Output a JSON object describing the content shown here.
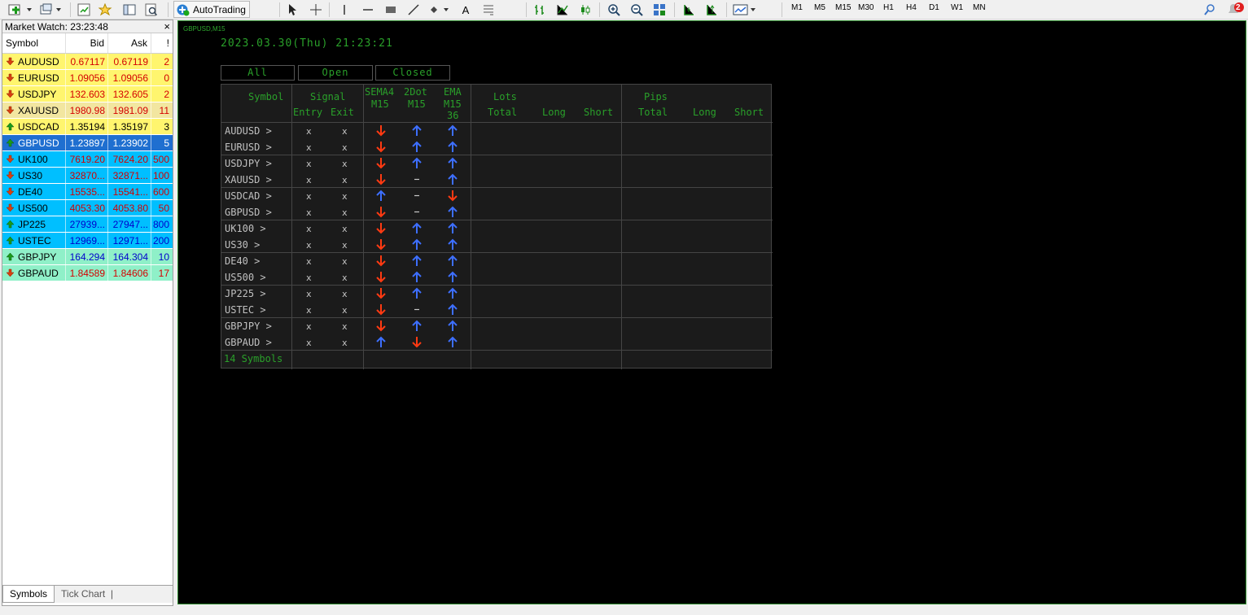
{
  "toolbar": {
    "autotrading_label": "AutoTrading",
    "timeframes": [
      "M1",
      "M5",
      "M15",
      "M30",
      "H1",
      "H4",
      "D1",
      "W1",
      "MN"
    ],
    "notification_count": "2"
  },
  "market_watch": {
    "title": "Market Watch: 23:23:48",
    "columns": {
      "symbol": "Symbol",
      "bid": "Bid",
      "ask": "Ask",
      "spread": "!"
    },
    "rows": [
      {
        "symbol": "AUDUSD",
        "bid": "0.67117",
        "ask": "0.67119",
        "spread": "2",
        "dir": "down",
        "bg": "#fff56e",
        "color": "#d40000"
      },
      {
        "symbol": "EURUSD",
        "bid": "1.09056",
        "ask": "1.09056",
        "spread": "0",
        "dir": "down",
        "bg": "#fff56e",
        "color": "#d40000"
      },
      {
        "symbol": "USDJPY",
        "bid": "132.603",
        "ask": "132.605",
        "spread": "2",
        "dir": "down",
        "bg": "#fff56e",
        "color": "#d40000"
      },
      {
        "symbol": "XAUUSD",
        "bid": "1980.98",
        "ask": "1981.09",
        "spread": "11",
        "dir": "down",
        "bg": "#f2e6a0",
        "color": "#d40000"
      },
      {
        "symbol": "USDCAD",
        "bid": "1.35194",
        "ask": "1.35197",
        "spread": "3",
        "dir": "up",
        "bg": "#fff56e",
        "color": "#000000"
      },
      {
        "symbol": "GBPUSD",
        "bid": "1.23897",
        "ask": "1.23902",
        "spread": "5",
        "dir": "up",
        "bg": "#1f6fd0",
        "color": "#ffffff",
        "selected": true
      },
      {
        "symbol": "UK100",
        "bid": "7619.20",
        "ask": "7624.20",
        "spread": "500",
        "dir": "down",
        "bg": "#00bfff",
        "color": "#d40000"
      },
      {
        "symbol": "US30",
        "bid": "32870...",
        "ask": "32871...",
        "spread": "100",
        "dir": "down",
        "bg": "#00bfff",
        "color": "#d40000"
      },
      {
        "symbol": "DE40",
        "bid": "15535...",
        "ask": "15541...",
        "spread": "600",
        "dir": "down",
        "bg": "#00bfff",
        "color": "#d40000"
      },
      {
        "symbol": "US500",
        "bid": "4053.30",
        "ask": "4053.80",
        "spread": "50",
        "dir": "down",
        "bg": "#00bfff",
        "color": "#d40000"
      },
      {
        "symbol": "JP225",
        "bid": "27939...",
        "ask": "27947...",
        "spread": "800",
        "dir": "up",
        "bg": "#00bfff",
        "color": "#0000cc"
      },
      {
        "symbol": "USTEC",
        "bid": "12969...",
        "ask": "12971...",
        "spread": "200",
        "dir": "up",
        "bg": "#00bfff",
        "color": "#0000cc"
      },
      {
        "symbol": "GBPJPY",
        "bid": "164.294",
        "ask": "164.304",
        "spread": "10",
        "dir": "up",
        "bg": "#8ff0c8",
        "color": "#0000cc"
      },
      {
        "symbol": "GBPAUD",
        "bid": "1.84589",
        "ask": "1.84606",
        "spread": "17",
        "dir": "down",
        "bg": "#8ff0c8",
        "color": "#d40000"
      }
    ],
    "tabs": [
      "Symbols",
      "Tick Chart"
    ]
  },
  "chart": {
    "label": "GBPUSD,M15",
    "datetime": "2023.03.30(Thu) 21:23:21",
    "filters": [
      "All",
      "Open",
      "Closed"
    ],
    "headers": {
      "symbol": "Symbol",
      "signal": "Signal",
      "entry": "Entry",
      "exit": "Exit",
      "sema_top": "SEMA4",
      "sema_bot": "M15",
      "dot_top": "2Dot",
      "dot_bot": "M15",
      "ema_top": "EMA",
      "ema_mid": "M15",
      "ema_bot": "36",
      "lots": "Lots",
      "lots_total": "Total",
      "lots_long": "Long",
      "lots_short": "Short",
      "pips": "Pips",
      "pips_total": "Total",
      "pips_long": "Long",
      "pips_short": "Short"
    },
    "rows": [
      {
        "symbol": "AUDUSD",
        "entry": "x",
        "exit": "x",
        "sema": "down",
        "dot": "up",
        "ema": "up"
      },
      {
        "symbol": "EURUSD",
        "entry": "x",
        "exit": "x",
        "sema": "down",
        "dot": "up",
        "ema": "up"
      },
      {
        "symbol": "USDJPY",
        "entry": "x",
        "exit": "x",
        "sema": "down",
        "dot": "up",
        "ema": "up"
      },
      {
        "symbol": "XAUUSD",
        "entry": "x",
        "exit": "x",
        "sema": "down",
        "dot": "-",
        "ema": "up"
      },
      {
        "symbol": "USDCAD",
        "entry": "x",
        "exit": "x",
        "sema": "up",
        "dot": "-",
        "ema": "down"
      },
      {
        "symbol": "GBPUSD",
        "entry": "x",
        "exit": "x",
        "sema": "down",
        "dot": "-",
        "ema": "up"
      },
      {
        "symbol": "UK100",
        "entry": "x",
        "exit": "x",
        "sema": "down",
        "dot": "up",
        "ema": "up"
      },
      {
        "symbol": "US30",
        "entry": "x",
        "exit": "x",
        "sema": "down",
        "dot": "up",
        "ema": "up"
      },
      {
        "symbol": "DE40",
        "entry": "x",
        "exit": "x",
        "sema": "down",
        "dot": "up",
        "ema": "up"
      },
      {
        "symbol": "US500",
        "entry": "x",
        "exit": "x",
        "sema": "down",
        "dot": "up",
        "ema": "up"
      },
      {
        "symbol": "JP225",
        "entry": "x",
        "exit": "x",
        "sema": "down",
        "dot": "up",
        "ema": "up"
      },
      {
        "symbol": "USTEC",
        "entry": "x",
        "exit": "x",
        "sema": "down",
        "dot": "-",
        "ema": "up"
      },
      {
        "symbol": "GBPJPY",
        "entry": "x",
        "exit": "x",
        "sema": "down",
        "dot": "up",
        "ema": "up"
      },
      {
        "symbol": "GBPAUD",
        "entry": "x",
        "exit": "x",
        "sema": "up",
        "dot": "down",
        "ema": "up"
      }
    ],
    "footer": "14 Symbols",
    "colors": {
      "up": "#3d6fff",
      "down": "#ff3a12",
      "text_green": "#2aa02a"
    }
  }
}
